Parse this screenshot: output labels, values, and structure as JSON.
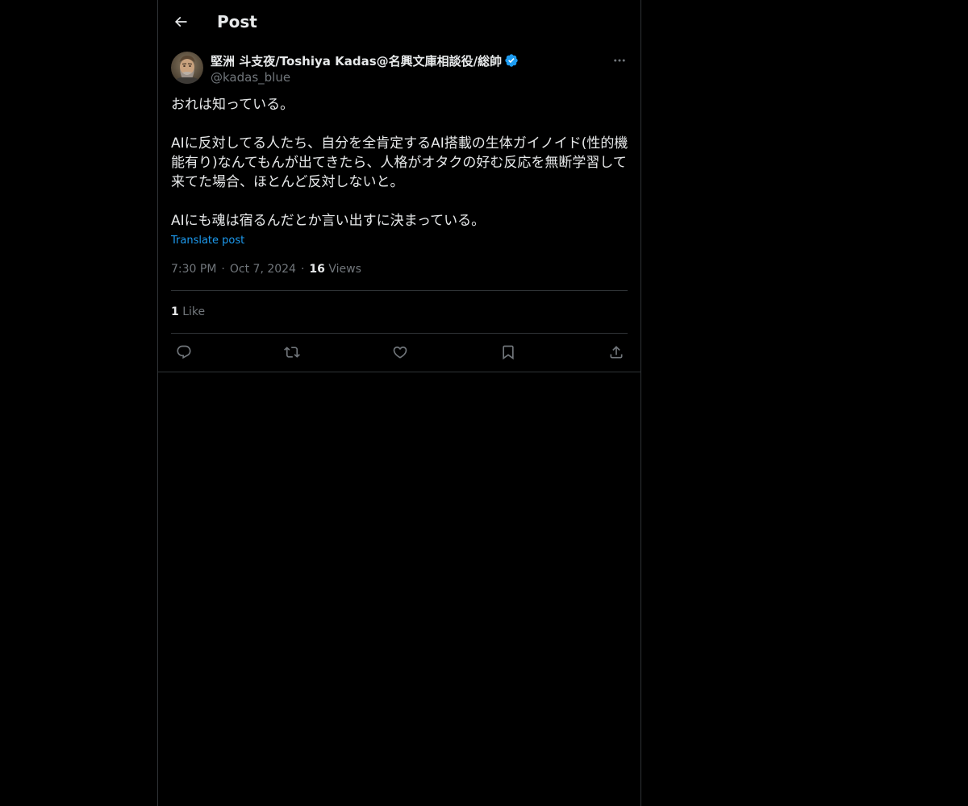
{
  "header": {
    "title": "Post"
  },
  "post": {
    "author": {
      "name": "堅洲 斗支夜/Toshiya Kadas@名興文庫相談役/総帥",
      "handle": "@kadas_blue"
    },
    "body": "おれは知っている。\n\nAIに反対してる人たち、自分を全肯定するAI搭載の生体ガイノイド(性的機\n能有り)なんてもんが出てきたら、人格がオタクの好む反応を無断学習して\n来てた場合、ほとんど反対しないと。\n\nAIにも魂は宿るんだとか言い出すに決まっている。",
    "translate_label": "Translate post",
    "time": "7:30 PM",
    "date": "Oct 7, 2024",
    "views_count": "16",
    "views_label": "Views",
    "likes_count": "1",
    "likes_label": "Like"
  },
  "icons": {
    "back": "arrow-left-icon",
    "verified": "verified-badge-icon",
    "more": "more-horizontal-icon",
    "reply": "reply-icon",
    "repost": "repost-icon",
    "like": "heart-icon",
    "bookmark": "bookmark-icon",
    "share": "share-icon"
  },
  "colors": {
    "background": "#000000",
    "text": "#e7e9ea",
    "secondary": "#71767b",
    "accent": "#1d9bf0",
    "border": "#2f3336"
  }
}
